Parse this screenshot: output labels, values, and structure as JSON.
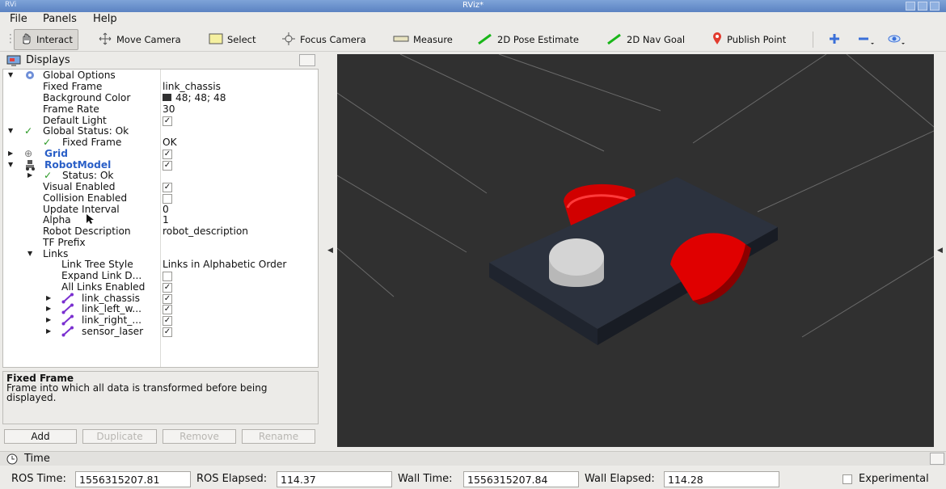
{
  "window": {
    "title": "RViz*",
    "title_left": "RVi"
  },
  "menu": {
    "file": "File",
    "panels": "Panels",
    "help": "Help"
  },
  "toolbar": {
    "interact": "Interact",
    "move_camera": "Move Camera",
    "select": "Select",
    "focus_camera": "Focus Camera",
    "measure": "Measure",
    "pose_estimate": "2D Pose Estimate",
    "nav_goal": "2D Nav Goal",
    "publish_point": "Publish Point"
  },
  "displays": {
    "title": "Displays",
    "global_options": "Global Options",
    "fixed_frame_label": "Fixed Frame",
    "fixed_frame_value": "link_chassis",
    "background_color_label": "Background Color",
    "background_color_value": "48; 48; 48",
    "frame_rate_label": "Frame Rate",
    "frame_rate_value": "30",
    "default_light_label": "Default Light",
    "global_status": "Global Status: Ok",
    "fixed_frame_status_label": "Fixed Frame",
    "fixed_frame_status_value": "OK",
    "grid": "Grid",
    "robot_model": "RobotModel",
    "status_ok": "Status: Ok",
    "visual_enabled": "Visual Enabled",
    "collision_enabled": "Collision Enabled",
    "update_interval_label": "Update Interval",
    "update_interval_value": "0",
    "alpha_label": "Alpha",
    "alpha_value": "1",
    "robot_description_label": "Robot Description",
    "robot_description_value": "robot_description",
    "tf_prefix": "TF Prefix",
    "links": "Links",
    "link_tree_style_label": "Link Tree Style",
    "link_tree_style_value": "Links in Alphabetic Order",
    "expand_link": "Expand Link D...",
    "all_links_enabled": "All Links Enabled",
    "link_items": [
      "link_chassis",
      "link_left_w...",
      "link_right_...",
      "sensor_laser"
    ]
  },
  "description": {
    "title": "Fixed Frame",
    "text": "Frame into which all data is transformed before being displayed."
  },
  "buttons": {
    "add": "Add",
    "duplicate": "Duplicate",
    "remove": "Remove",
    "rename": "Rename"
  },
  "time": {
    "title": "Time",
    "ros_time_label": "ROS Time:",
    "ros_time": "1556315207.81",
    "ros_elapsed_label": "ROS Elapsed:",
    "ros_elapsed": "114.37",
    "wall_time_label": "Wall Time:",
    "wall_time": "1556315207.84",
    "wall_elapsed_label": "Wall Elapsed:",
    "wall_elapsed": "114.28",
    "experimental": "Experimental"
  },
  "colors": {
    "viewport_bg": "#303030",
    "wheel": "#e00000",
    "chassis": "#2e3440",
    "link_blue": "#2a5fc7"
  },
  "icons": [
    "interact-icon",
    "move-camera-icon",
    "select-icon",
    "focus-camera-icon",
    "measure-icon",
    "pose-estimate-icon",
    "nav-goal-icon",
    "publish-point-icon",
    "plus-icon",
    "minus-icon",
    "eye-icon",
    "displays-icon",
    "gear-icon",
    "check-icon",
    "grid-icon",
    "robot-icon",
    "link-icon",
    "clock-icon"
  ]
}
